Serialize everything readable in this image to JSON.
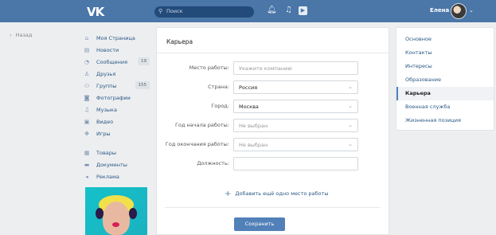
{
  "header": {
    "logo": "VK",
    "search_placeholder": "Поиск",
    "user_name": "Елена"
  },
  "back_link": "Назад",
  "nav": {
    "items": [
      {
        "label": "Моя Страница",
        "icon": "home-icon"
      },
      {
        "label": "Новости",
        "icon": "news-icon"
      },
      {
        "label": "Сообщения",
        "icon": "messages-icon",
        "count": "19"
      },
      {
        "label": "Друзья",
        "icon": "friends-icon"
      },
      {
        "label": "Группы",
        "icon": "groups-icon",
        "count": "155"
      },
      {
        "label": "Фотографии",
        "icon": "camera-icon"
      },
      {
        "label": "Музыка",
        "icon": "music-icon"
      },
      {
        "label": "Видео",
        "icon": "video-icon"
      },
      {
        "label": "Игры",
        "icon": "games-icon"
      },
      {
        "label": "Товары",
        "icon": "goods-icon"
      },
      {
        "label": "Документы",
        "icon": "documents-icon"
      },
      {
        "label": "Реклама",
        "icon": "ads-icon"
      }
    ]
  },
  "form": {
    "title": "Карьера",
    "fields": [
      {
        "label": "Место работы:",
        "value": "",
        "placeholder": "Укажите компанию",
        "type": "text"
      },
      {
        "label": "Страна:",
        "value": "Россия",
        "type": "select"
      },
      {
        "label": "Город:",
        "value": "Москва",
        "type": "select"
      },
      {
        "label": "Год начала работы:",
        "value": "",
        "placeholder": "Не выбран",
        "type": "select"
      },
      {
        "label": "Год окончания работы:",
        "value": "",
        "placeholder": "Не выбран",
        "type": "select"
      },
      {
        "label": "Должность:",
        "value": "",
        "placeholder": "",
        "type": "text"
      }
    ],
    "add_work": "Добавить ещё одно место работы",
    "save": "Сохранить"
  },
  "side_menu": {
    "items": [
      "Основное",
      "Контакты",
      "Интересы",
      "Образование",
      "Карьера",
      "Военная служба",
      "Жизненная позиция"
    ],
    "active": "Карьера"
  }
}
